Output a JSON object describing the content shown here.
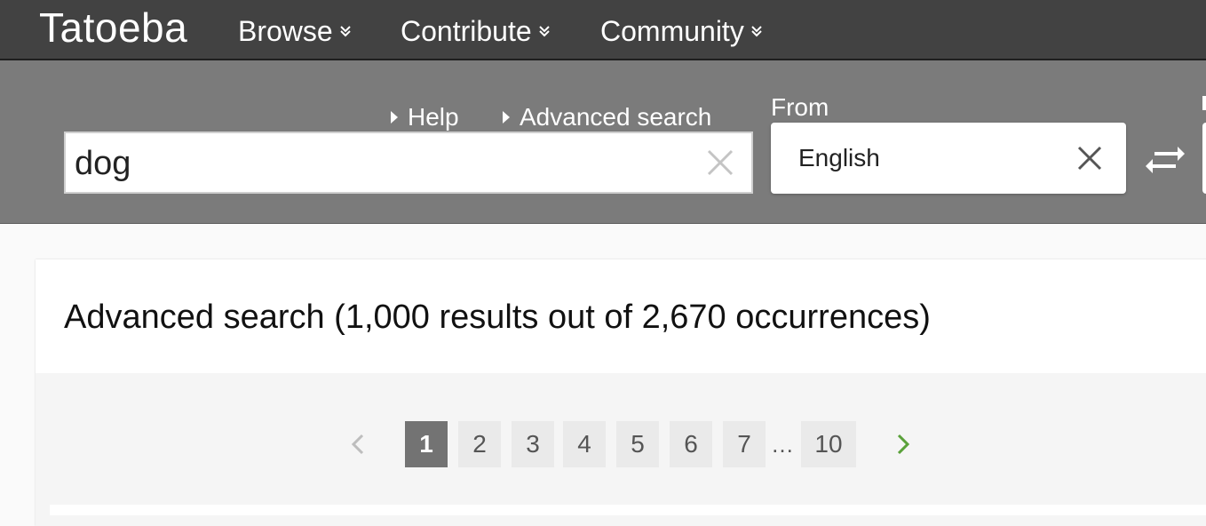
{
  "nav": {
    "logo": "Tatoeba",
    "items": [
      {
        "label": "Browse",
        "icon": "chevron-double-down-icon"
      },
      {
        "label": "Contribute",
        "icon": "chevron-double-down-icon"
      },
      {
        "label": "Community",
        "icon": "chevron-double-down-icon"
      }
    ]
  },
  "search": {
    "help_link": "Help",
    "advanced_link": "Advanced search",
    "query": "dog",
    "clear_icon": "close-icon",
    "from_label": "From",
    "from_value": "English",
    "swap_icon": "swap-arrows-icon"
  },
  "results": {
    "title": "Advanced search (1,000 results out of 2,670 occurrences)"
  },
  "pagination": {
    "prev_icon": "chevron-left-icon",
    "next_icon": "chevron-right-icon",
    "pages": [
      "1",
      "2",
      "3",
      "4",
      "5",
      "6",
      "7"
    ],
    "ellipsis": "…",
    "last_page": "10",
    "current": "1",
    "colors": {
      "active_bg": "#737373",
      "inactive_bg": "#eaeaea",
      "next_arrow": "#5aa13a",
      "prev_arrow": "#bdbdbd"
    }
  },
  "colors": {
    "topbar": "#424242",
    "searchbar": "#7b7b7b"
  }
}
